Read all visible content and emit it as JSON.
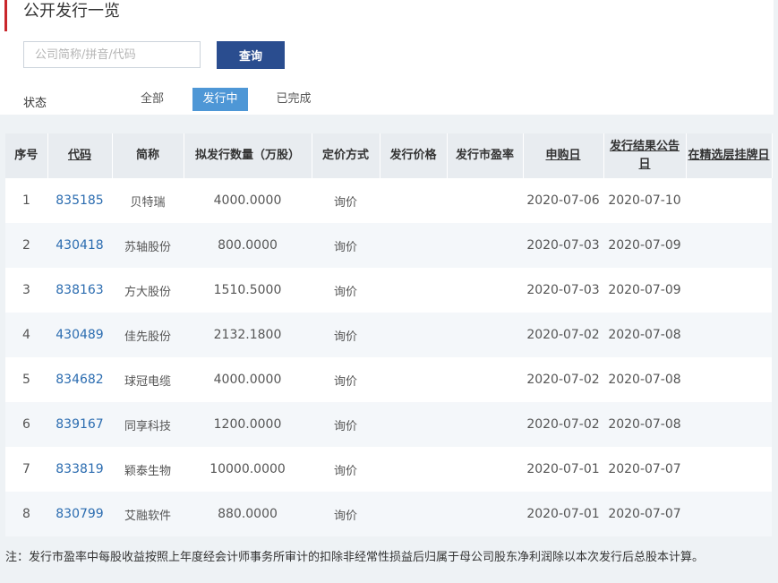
{
  "header": {
    "title": "公开发行一览"
  },
  "search": {
    "placeholder": "公司简称/拼音/代码",
    "value": "",
    "button_label": "查询"
  },
  "filter": {
    "label": "状态",
    "tabs": [
      {
        "label": "全部",
        "active": false
      },
      {
        "label": "发行中",
        "active": true
      },
      {
        "label": "已完成",
        "active": false
      }
    ]
  },
  "table": {
    "columns": [
      "序号",
      "代码",
      "简称",
      "拟发行数量（万股）",
      "定价方式",
      "发行价格",
      "发行市盈率",
      "申购日",
      "发行结果公告日",
      "在精选层挂牌日"
    ],
    "rows": [
      {
        "no": "1",
        "code": "835185",
        "name": "贝特瑞",
        "qty": "4000.0000",
        "method": "询价",
        "price": "",
        "pe": "",
        "subscribe": "2020-07-06",
        "result": "2020-07-10",
        "listing": ""
      },
      {
        "no": "2",
        "code": "430418",
        "name": "苏轴股份",
        "qty": "800.0000",
        "method": "询价",
        "price": "",
        "pe": "",
        "subscribe": "2020-07-03",
        "result": "2020-07-09",
        "listing": ""
      },
      {
        "no": "3",
        "code": "838163",
        "name": "方大股份",
        "qty": "1510.5000",
        "method": "询价",
        "price": "",
        "pe": "",
        "subscribe": "2020-07-03",
        "result": "2020-07-09",
        "listing": ""
      },
      {
        "no": "4",
        "code": "430489",
        "name": "佳先股份",
        "qty": "2132.1800",
        "method": "询价",
        "price": "",
        "pe": "",
        "subscribe": "2020-07-02",
        "result": "2020-07-08",
        "listing": ""
      },
      {
        "no": "5",
        "code": "834682",
        "name": "球冠电缆",
        "qty": "4000.0000",
        "method": "询价",
        "price": "",
        "pe": "",
        "subscribe": "2020-07-02",
        "result": "2020-07-08",
        "listing": ""
      },
      {
        "no": "6",
        "code": "839167",
        "name": "同享科技",
        "qty": "1200.0000",
        "method": "询价",
        "price": "",
        "pe": "",
        "subscribe": "2020-07-02",
        "result": "2020-07-08",
        "listing": ""
      },
      {
        "no": "7",
        "code": "833819",
        "name": "颖泰生物",
        "qty": "10000.0000",
        "method": "询价",
        "price": "",
        "pe": "",
        "subscribe": "2020-07-01",
        "result": "2020-07-07",
        "listing": ""
      },
      {
        "no": "8",
        "code": "830799",
        "name": "艾融软件",
        "qty": "880.0000",
        "method": "询价",
        "price": "",
        "pe": "",
        "subscribe": "2020-07-01",
        "result": "2020-07-07",
        "listing": ""
      }
    ]
  },
  "footnote": "注：发行市盈率中每股收益按照上年度经会计师事务所审计的扣除非经常性损益后归属于母公司股东净利润除以本次发行后总股本计算。",
  "colors": {
    "accent_red": "#c9262b",
    "button_blue": "#2a4d8f",
    "active_tab": "#4e97d6",
    "link": "#2b6cb0"
  }
}
